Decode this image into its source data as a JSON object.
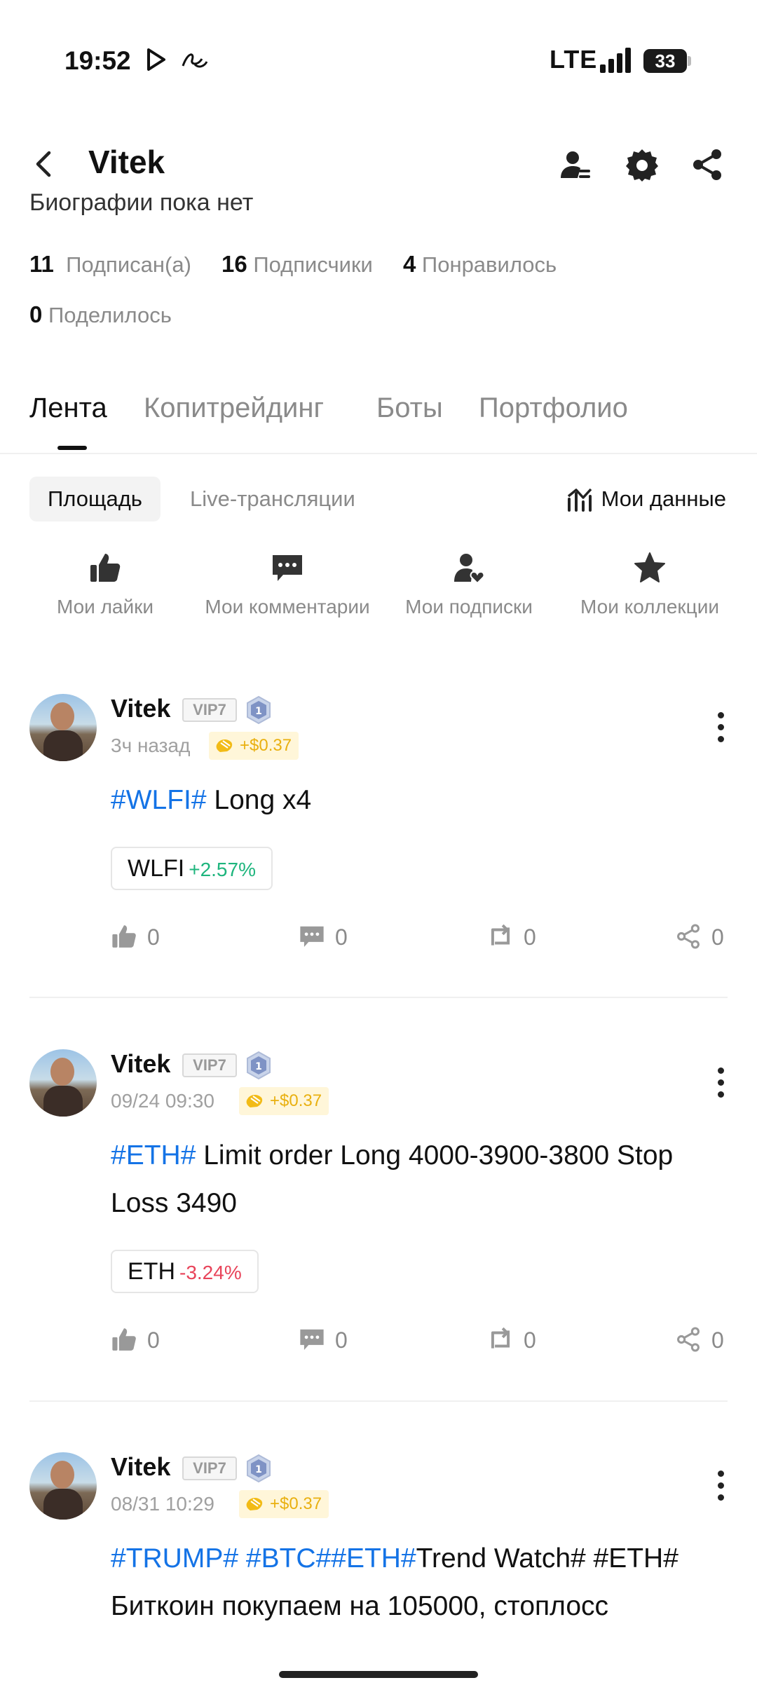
{
  "status_bar": {
    "time": "19:52",
    "network": "LTE",
    "battery": "33"
  },
  "header": {
    "title": "Vitek"
  },
  "profile": {
    "bio": "Биографии пока нет",
    "stats": [
      {
        "value": "11",
        "label": "Подписан(а)"
      },
      {
        "value": "16",
        "label": "Подписчики"
      },
      {
        "value": "4",
        "label": "Понравилось"
      },
      {
        "value": "0",
        "label": "Поделилось"
      }
    ]
  },
  "tabs": [
    "Лента",
    "Копитрейдинг",
    "Боты",
    "Портфолио"
  ],
  "active_tab": "Лента",
  "sub_tabs": {
    "active": "Площадь",
    "other": "Live-трансляции",
    "my_data": "Мои данные"
  },
  "quick_actions": [
    {
      "label": "Мои лайки",
      "icon": "thumbs-up-icon"
    },
    {
      "label": "Мои комментарии",
      "icon": "comment-icon"
    },
    {
      "label": "Мои подписки",
      "icon": "user-heart-icon"
    },
    {
      "label": "Мои коллекции",
      "icon": "star-icon"
    }
  ],
  "posts": [
    {
      "author": "Vitek",
      "vip": "VIP7",
      "level": "1",
      "time": "3ч назад",
      "reward": "+$0.37",
      "tags": [
        "#WLFI#"
      ],
      "text": " Long x4",
      "ticker": {
        "symbol": "WLFI",
        "change": "+2.57%",
        "direction": "up"
      },
      "likes": "0",
      "comments": "0",
      "reposts": "0",
      "shares": "0"
    },
    {
      "author": "Vitek",
      "vip": "VIP7",
      "level": "1",
      "time": "09/24 09:30",
      "reward": "+$0.37",
      "tags": [
        "#ETH#"
      ],
      "text": " Limit order Long 4000-3900-3800 Stop Loss 3490",
      "ticker": {
        "symbol": "ETH",
        "change": "-3.24%",
        "direction": "down"
      },
      "likes": "0",
      "comments": "0",
      "reposts": "0",
      "shares": "0"
    },
    {
      "author": "Vitek",
      "vip": "VIP7",
      "level": "1",
      "time": "08/31 10:29",
      "reward": "+$0.37",
      "tags": [
        "#TRUMP#",
        " #BTC#",
        "#ETH#"
      ],
      "text": "Trend Watch# #ETH#",
      "next_line": "Биткоин покупаем на 105000, стоплосс"
    }
  ],
  "colors": {
    "accent": "#1473e6",
    "up": "#1eb57d",
    "down": "#e8445a",
    "reward": "#e9b010"
  }
}
